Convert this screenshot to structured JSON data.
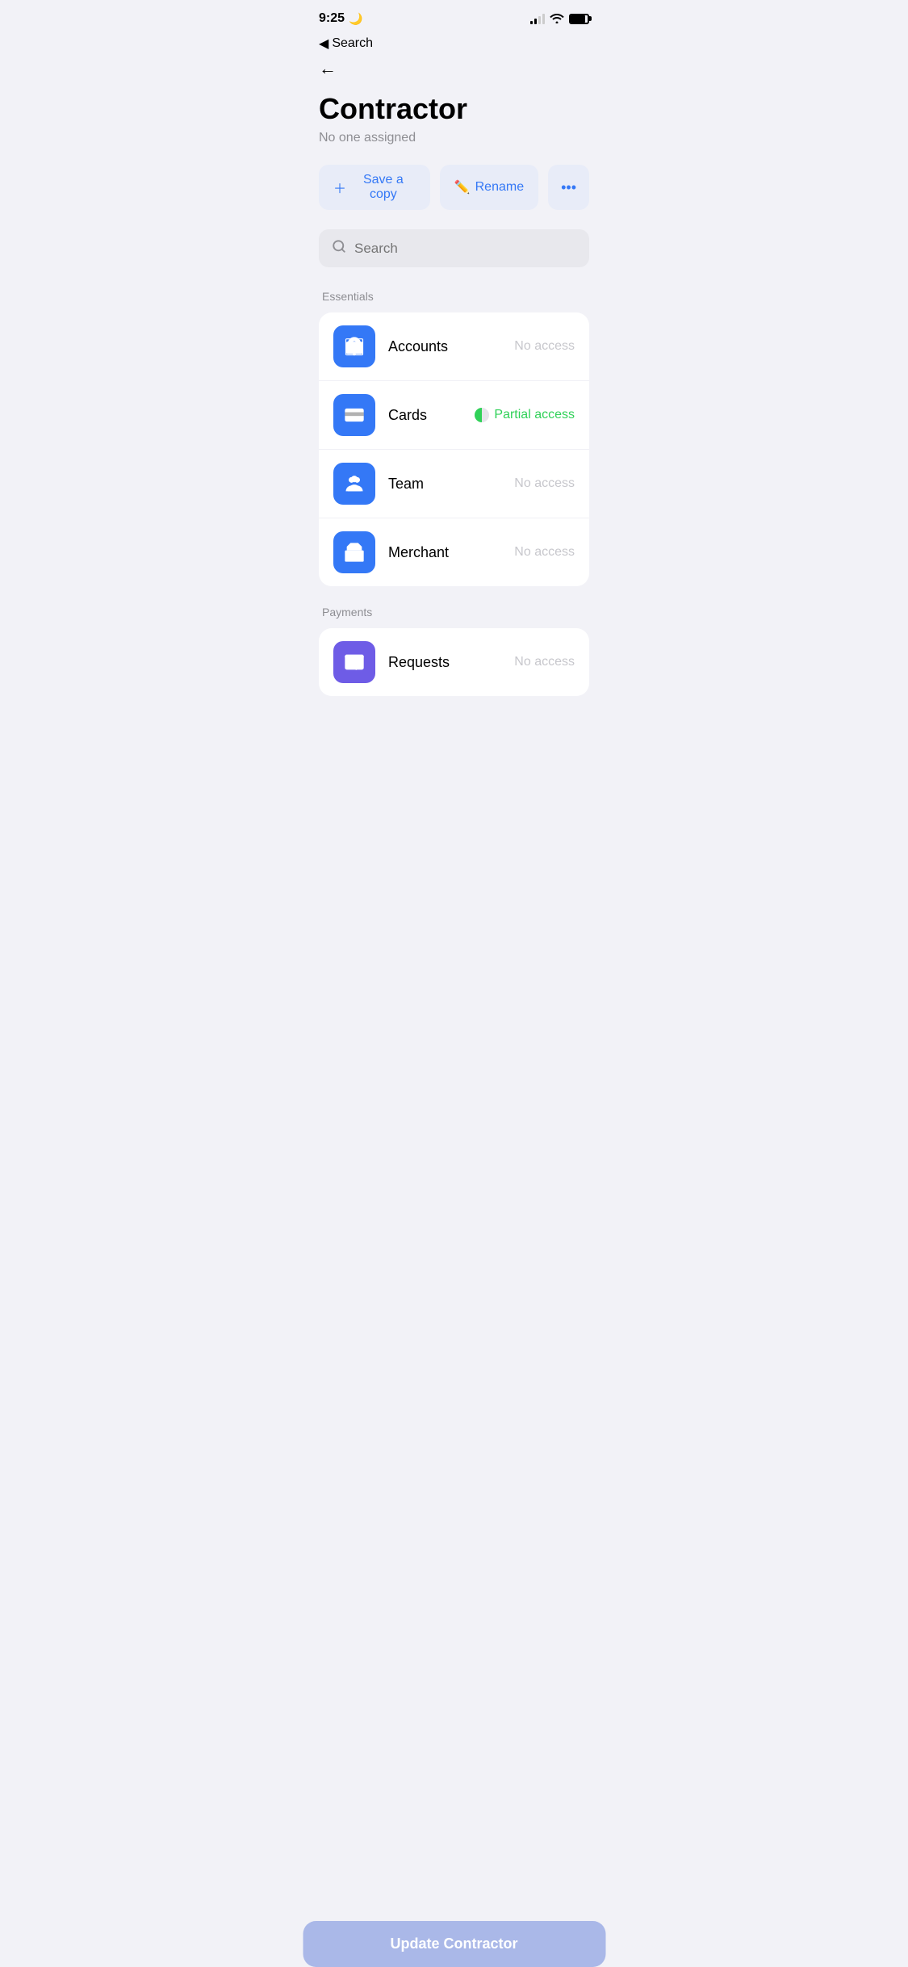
{
  "statusBar": {
    "time": "9:25",
    "moonIcon": "🌙"
  },
  "nav": {
    "backLabel": "Search"
  },
  "page": {
    "backArrow": "←",
    "title": "Contractor",
    "subtitle": "No one assigned"
  },
  "actions": {
    "saveCopy": "Save a copy",
    "rename": "Rename",
    "more": "•••"
  },
  "search": {
    "placeholder": "Search"
  },
  "essentials": {
    "sectionLabel": "Essentials",
    "items": [
      {
        "name": "Accounts",
        "access": "No access",
        "accessType": "none",
        "icon": "accounts"
      },
      {
        "name": "Cards",
        "access": "Partial access",
        "accessType": "partial",
        "icon": "cards"
      },
      {
        "name": "Team",
        "access": "No access",
        "accessType": "none",
        "icon": "team"
      },
      {
        "name": "Merchant",
        "access": "No access",
        "accessType": "none",
        "icon": "merchant"
      }
    ]
  },
  "payments": {
    "sectionLabel": "Payments",
    "items": [
      {
        "name": "Requests",
        "access": "No access",
        "accessType": "none",
        "icon": "requests"
      }
    ]
  },
  "updateBtn": "Update Contractor"
}
